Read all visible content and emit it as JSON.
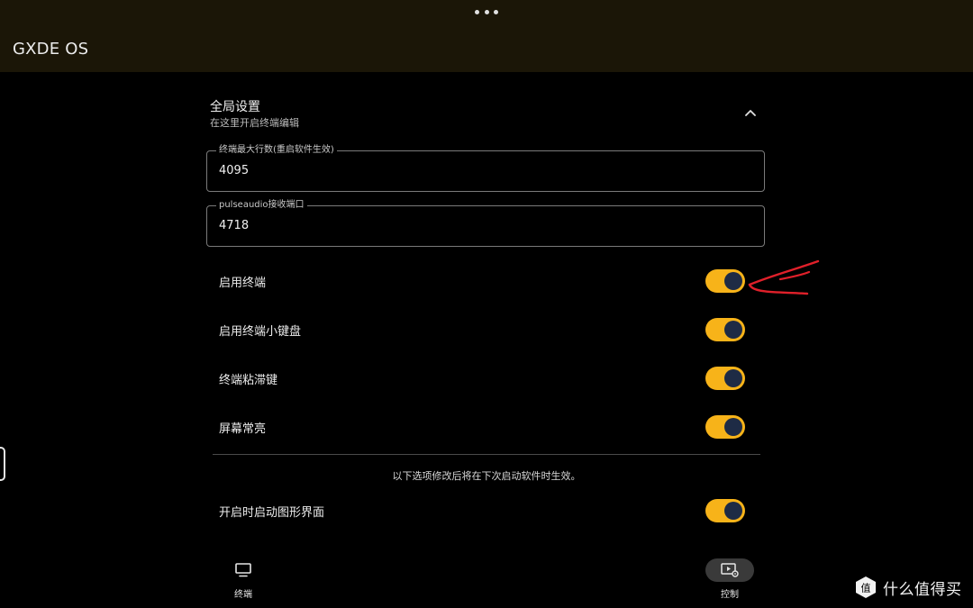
{
  "app": {
    "title": "GXDE OS"
  },
  "global_settings": {
    "title": "全局设置",
    "subtitle": "在这里开启终端编辑",
    "expanded": true
  },
  "fields": {
    "max_lines": {
      "label": "终端最大行数(重启软件生效)",
      "value": "4095"
    },
    "pulseaudio_port": {
      "label": "pulseaudio接收端口",
      "value": "4718"
    }
  },
  "toggles": [
    {
      "label": "启用终端",
      "on": true
    },
    {
      "label": "启用终端小键盘",
      "on": true
    },
    {
      "label": "终端粘滞键",
      "on": true
    },
    {
      "label": "屏幕常亮",
      "on": true
    }
  ],
  "restart_note": "以下选项修改后将在下次启动软件时生效。",
  "restart_toggles": [
    {
      "label": "开启时启动图形界面",
      "on": true
    }
  ],
  "bottom_nav": {
    "items": [
      {
        "label": "终端",
        "icon": "monitor-icon",
        "active": false
      },
      {
        "label": "控制",
        "icon": "video-settings-icon",
        "active": true
      }
    ]
  },
  "watermark": {
    "text": "什么值得买",
    "badge": "值"
  },
  "colors": {
    "appbar_bg": "#1b1607",
    "switch_track": "#f7b319",
    "switch_knob": "#1e2b45",
    "annotation": "#e0202a"
  }
}
